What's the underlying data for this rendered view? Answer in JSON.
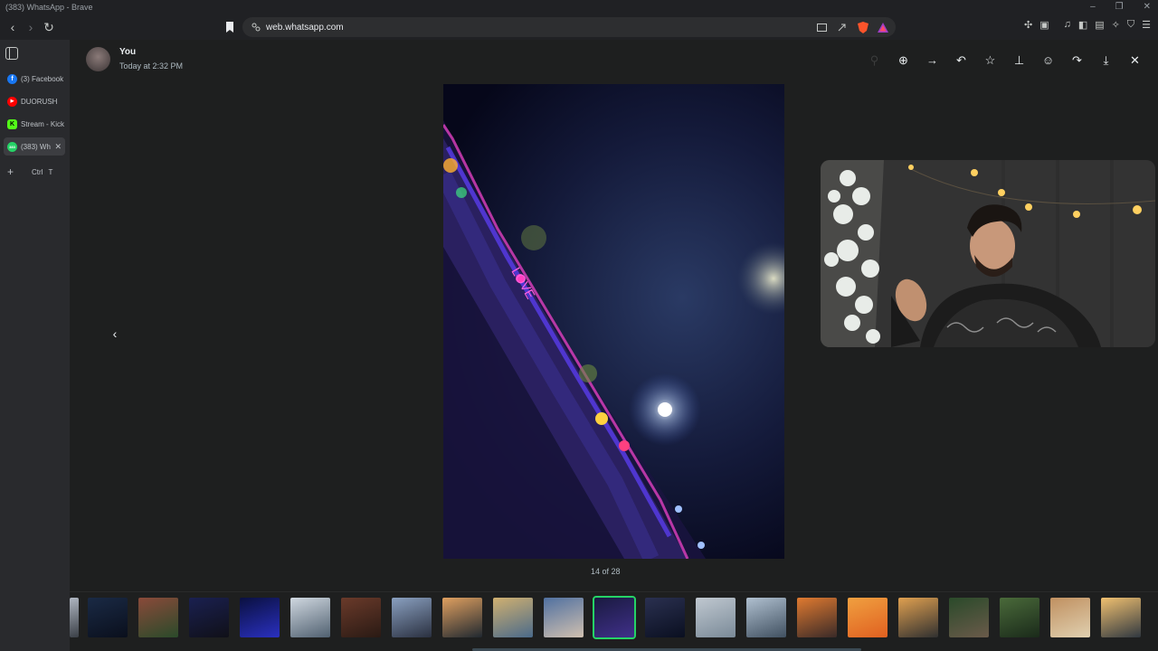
{
  "window": {
    "title": "(383) WhatsApp - Brave",
    "controls": [
      "–",
      "❐",
      "✕"
    ]
  },
  "browser": {
    "url": "web.whatsapp.com",
    "nav": {
      "back": "‹",
      "forward": "›",
      "reload": "↻"
    }
  },
  "sidebar": {
    "tabs": [
      {
        "label": "(3) Facebook",
        "icon": "facebook-icon",
        "color": "#1877f2",
        "glyph": "f"
      },
      {
        "label": "DUORUSH",
        "icon": "youtube-icon",
        "color": "#ff0000",
        "glyph": "▶"
      },
      {
        "label": "Stream - Kick",
        "icon": "kick-icon",
        "color": "#53fc18",
        "glyph": "K"
      },
      {
        "label": "(383) WhatsApp",
        "icon": "whatsapp-icon",
        "color": "#25d366",
        "glyph": "383"
      }
    ],
    "new_tab": {
      "plus": "+",
      "shortcut_key1": "Ctrl",
      "shortcut_key2": "T"
    }
  },
  "viewer": {
    "sender": "You",
    "timestamp": "Today at 2:32 PM",
    "counter": "14 of 28",
    "actions": [
      {
        "name": "zoom-in-icon",
        "glyph": "⊕"
      },
      {
        "name": "forward-arrow-icon",
        "glyph": "→"
      },
      {
        "name": "reply-icon",
        "glyph": "↶"
      },
      {
        "name": "star-icon",
        "glyph": "☆"
      },
      {
        "name": "pin-icon",
        "glyph": "⊥"
      },
      {
        "name": "emoji-icon",
        "glyph": "☺"
      },
      {
        "name": "share-icon",
        "glyph": "↷"
      },
      {
        "name": "download-icon",
        "glyph": "⤓"
      },
      {
        "name": "close-icon",
        "glyph": "✕"
      }
    ],
    "thumbnails": [
      {
        "colors": [
          "#b0b7c2",
          "#3a3f46"
        ]
      },
      {
        "colors": [
          "#1a2a45",
          "#0a0f1c"
        ]
      },
      {
        "colors": [
          "#8a4a3a",
          "#2a4a2a"
        ]
      },
      {
        "colors": [
          "#1a2050",
          "#101018"
        ]
      },
      {
        "colors": [
          "#0a1040",
          "#2a30c0"
        ]
      },
      {
        "colors": [
          "#d0d8e0",
          "#506070"
        ]
      },
      {
        "colors": [
          "#6a3a2a",
          "#2a1a14"
        ]
      },
      {
        "colors": [
          "#8aa0c0",
          "#2a3040"
        ]
      },
      {
        "colors": [
          "#e0a060",
          "#202830"
        ]
      },
      {
        "colors": [
          "#d0b070",
          "#4a6a8a"
        ]
      },
      {
        "colors": [
          "#5070a0",
          "#d0c0b0"
        ]
      },
      {
        "colors": [
          "#1a1a40",
          "#40308a"
        ]
      },
      {
        "colors": [
          "#2a3050",
          "#0a0f20"
        ]
      },
      {
        "colors": [
          "#c0c8d0",
          "#7a8a98"
        ]
      },
      {
        "colors": [
          "#b0c0d0",
          "#405060"
        ]
      },
      {
        "colors": [
          "#e07a30",
          "#3a2a28"
        ]
      },
      {
        "colors": [
          "#f0a040",
          "#e06020"
        ]
      },
      {
        "colors": [
          "#e0a050",
          "#303030"
        ]
      },
      {
        "colors": [
          "#2a4a2a",
          "#6a5a4a"
        ]
      },
      {
        "colors": [
          "#4a6a3a",
          "#1a2a1a"
        ]
      },
      {
        "colors": [
          "#c09060",
          "#e0d0b0"
        ]
      },
      {
        "colors": [
          "#f0c070",
          "#303840"
        ]
      }
    ]
  },
  "colors": {
    "accent": "#25d366",
    "viewer_bg": "#1e1f1f",
    "sidebar_bg": "#292a2d"
  }
}
